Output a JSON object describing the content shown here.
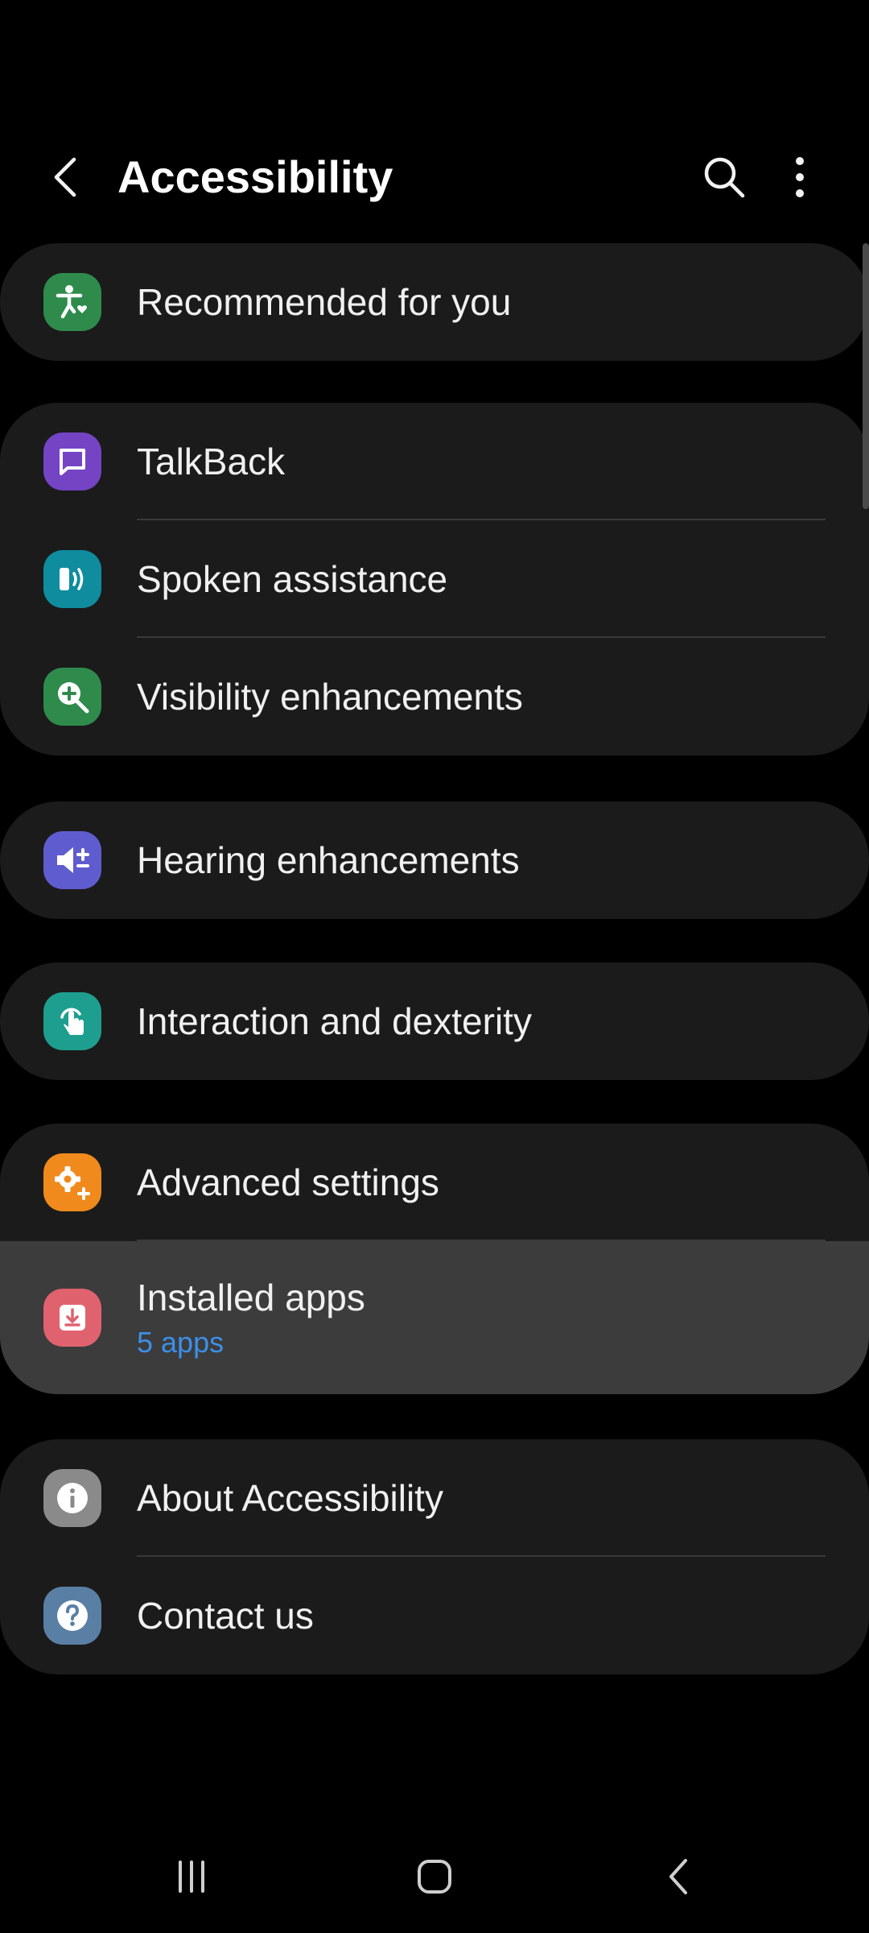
{
  "header": {
    "title": "Accessibility",
    "back_icon": "chevron-left-icon",
    "search_icon": "search-icon",
    "more_icon": "more-vert-icon"
  },
  "cards": [
    {
      "items": [
        {
          "label": "Recommended for you",
          "icon": "accessibility-person-icon",
          "icon_color": "#2e8b4c"
        }
      ]
    },
    {
      "items": [
        {
          "label": "TalkBack",
          "icon": "chat-bubble-icon",
          "icon_color": "#7444c4"
        },
        {
          "label": "Spoken assistance",
          "icon": "sound-wave-icon",
          "icon_color": "#0f8c9e"
        },
        {
          "label": "Visibility enhancements",
          "icon": "zoom-in-icon",
          "icon_color": "#2e8b4c"
        }
      ]
    },
    {
      "items": [
        {
          "label": "Hearing enhancements",
          "icon": "volume-plus-icon",
          "icon_color": "#5f5ccf"
        }
      ]
    },
    {
      "items": [
        {
          "label": "Interaction and dexterity",
          "icon": "touch-hand-icon",
          "icon_color": "#1e9e8e"
        }
      ]
    },
    {
      "items": [
        {
          "label": "Advanced settings",
          "icon": "gear-plus-icon",
          "icon_color": "#f08a1c"
        },
        {
          "label": "Installed apps",
          "sublabel": "5 apps",
          "icon": "download-icon",
          "icon_color": "#e0626f",
          "highlighted": true
        }
      ]
    },
    {
      "items": [
        {
          "label": "About Accessibility",
          "icon": "info-icon",
          "icon_color": "#8a8a8a"
        },
        {
          "label": "Contact us",
          "icon": "help-icon",
          "icon_color": "#5a7fa4"
        }
      ]
    }
  ],
  "navbar": {
    "recents_icon": "recents-icon",
    "home_icon": "home-icon",
    "back_icon": "back-icon"
  },
  "colors": {
    "background": "#000000",
    "card": "#1b1b1b",
    "highlight": "#3c3c3c",
    "accent_link": "#3d8fe8"
  }
}
